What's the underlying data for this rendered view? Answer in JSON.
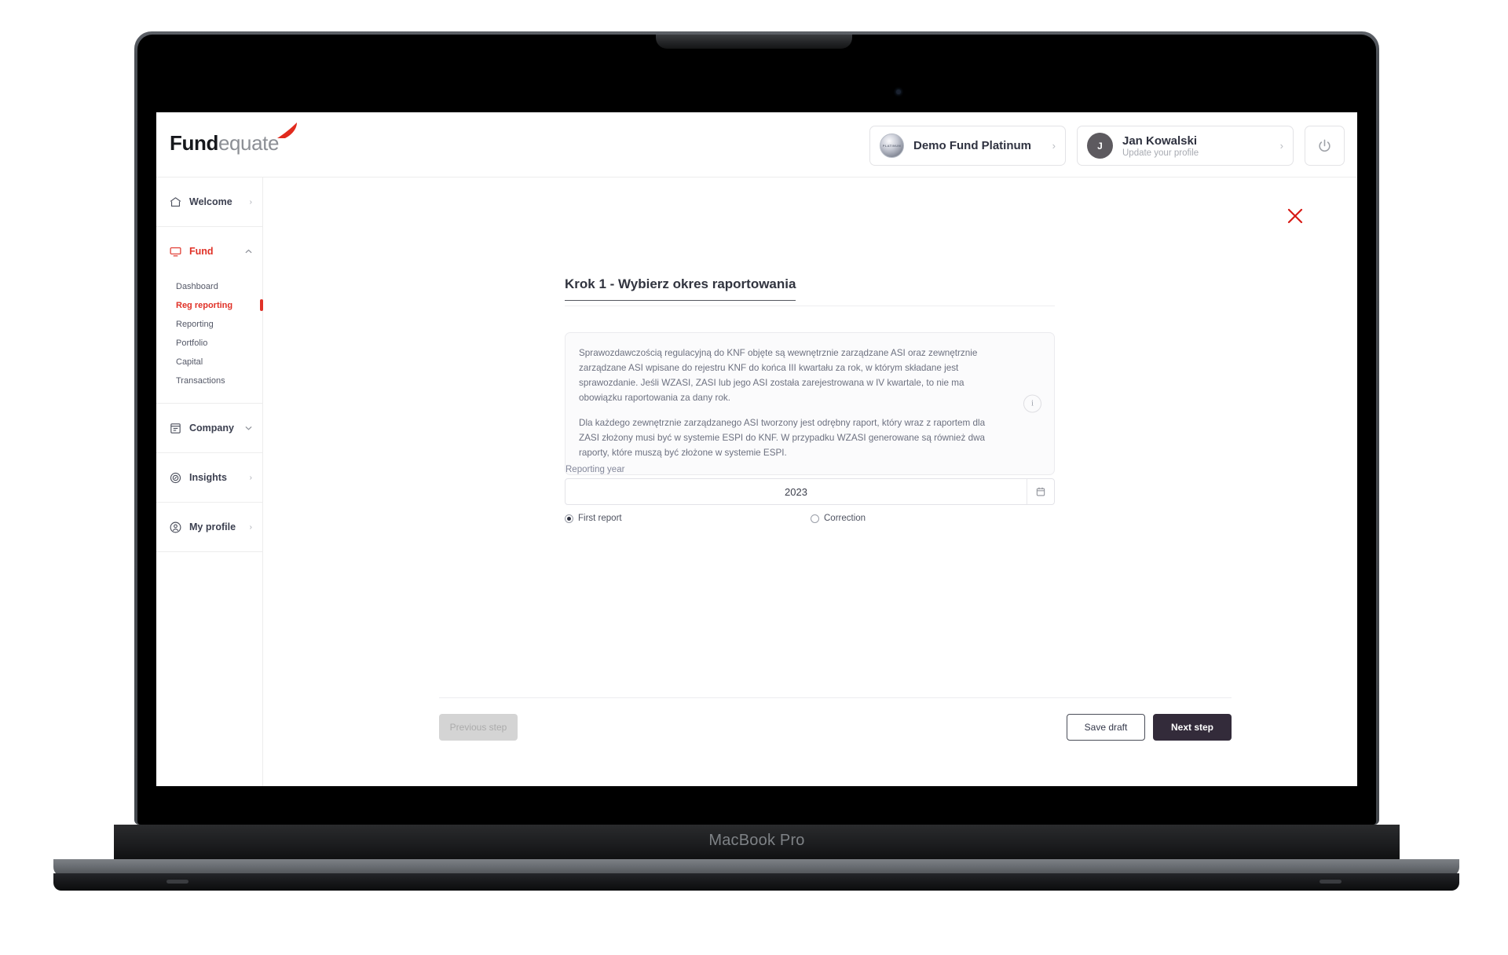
{
  "device": {
    "label": "MacBook Pro"
  },
  "header": {
    "logo": {
      "bold_part": "Fund",
      "light_part": "equate",
      "accent_color": "#e12a1d",
      "swoosh_icon": "red-swoosh-icon"
    },
    "fund_card": {
      "title": "Demo Fund Platinum",
      "badge_text": "PLATINUM",
      "chevron": "›"
    },
    "user_card": {
      "name": "Jan Kowalski",
      "subtitle": "Update your profile",
      "avatar_initial": "J",
      "chevron": "›"
    },
    "power_button_label": "power-icon"
  },
  "sidebar": {
    "items": [
      {
        "label": "Welcome",
        "icon": "home-icon",
        "chevron": "›",
        "active": false
      },
      {
        "label": "Fund",
        "icon": "monitor-icon",
        "chevron": "⌃",
        "active": true
      },
      {
        "label": "Company",
        "icon": "document-window-icon",
        "chevron": "⌄",
        "active": false
      },
      {
        "label": "Insights",
        "icon": "compass-icon",
        "chevron": "›",
        "active": false
      },
      {
        "label": "My profile",
        "icon": "user-badge-icon",
        "chevron": "›",
        "active": false
      }
    ],
    "fund_subitems": [
      {
        "label": "Dashboard",
        "active": false
      },
      {
        "label": "Reg reporting",
        "active": true
      },
      {
        "label": "Reporting",
        "active": false
      },
      {
        "label": "Portfolio",
        "active": false
      },
      {
        "label": "Capital",
        "active": false
      },
      {
        "label": "Transactions",
        "active": false
      }
    ],
    "active_color": "#e03127"
  },
  "main": {
    "close_label": "close-icon",
    "step_title": "Krok 1 - Wybierz okres raportowania",
    "info_box": {
      "paragraphs": [
        "Sprawozdawczością regulacyjną do KNF objęte są wewnętrznie zarządzane ASI oraz zewnętrznie zarządzane ASI wpisane do rejestru KNF do końca III kwartału za rok, w którym składane jest sprawozdanie. Jeśli WZASI, ZASI lub jego ASI została zarejestrowana w IV kwartale, to nie ma obowiązku raportowania za dany rok.",
        "Dla każdego zewnętrznie zarządzanego ASI tworzony jest odrębny raport, który wraz z raportem dla ZASI złożony musi być w systemie ESPI do KNF. W przypadku WZASI generowane są również dwa raporty, które muszą być złożone w systemie ESPI."
      ],
      "icon": "info-icon",
      "icon_glyph": "i"
    },
    "form": {
      "year_label": "Reporting year",
      "year_value": "2023",
      "calendar_icon": "calendar-icon",
      "radio_options": [
        {
          "label": "First report",
          "selected": true
        },
        {
          "label": "Correction",
          "selected": false
        }
      ]
    },
    "footer": {
      "previous_label": "Previous step",
      "previous_disabled": true,
      "save_label": "Save draft",
      "next_label": "Next step",
      "next_color": "#332b3a"
    }
  }
}
